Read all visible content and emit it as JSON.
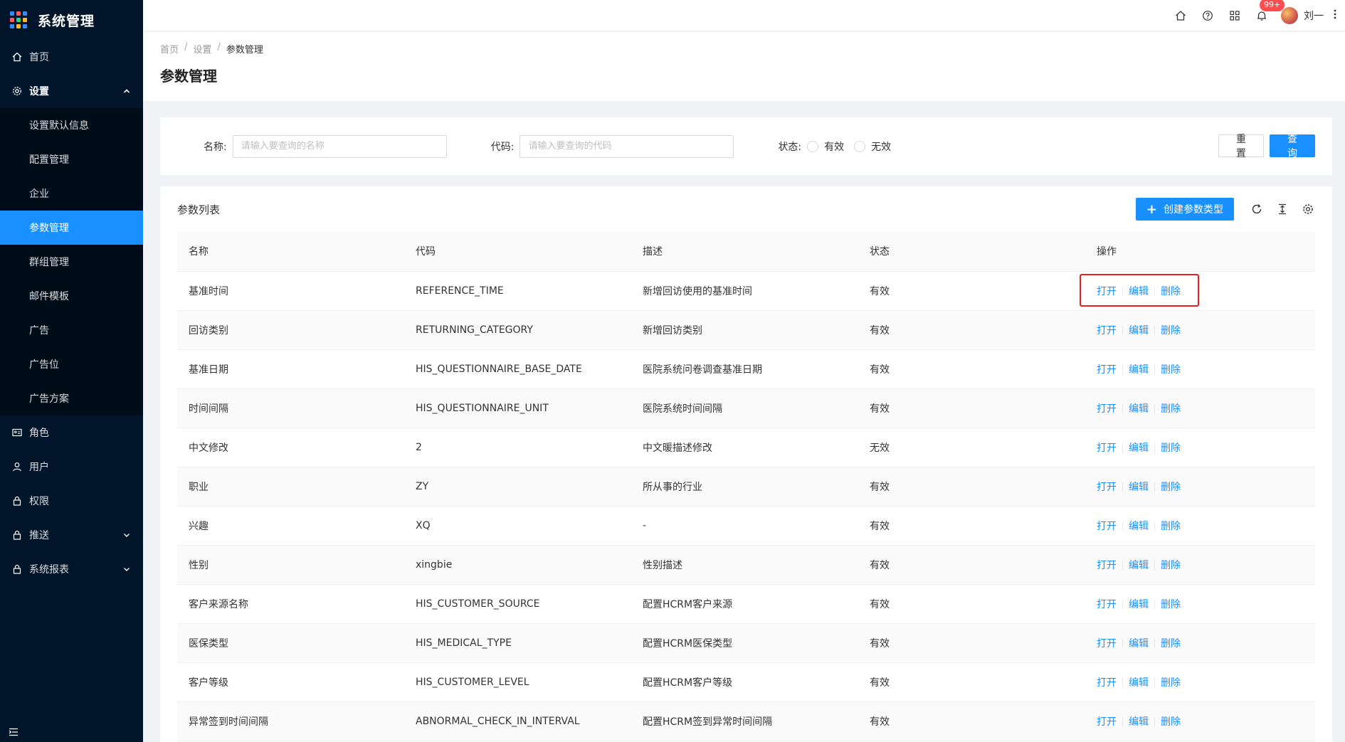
{
  "app": {
    "title": "系统管理"
  },
  "sidebar": {
    "home": "首页",
    "settings": "设置",
    "settings_children": [
      {
        "label": "设置默认信息",
        "active": false
      },
      {
        "label": "配置管理",
        "active": false
      },
      {
        "label": "企业",
        "active": false
      },
      {
        "label": "参数管理",
        "active": true
      },
      {
        "label": "群组管理",
        "active": false
      },
      {
        "label": "邮件模板",
        "active": false
      },
      {
        "label": "广告",
        "active": false
      },
      {
        "label": "广告位",
        "active": false
      },
      {
        "label": "广告方案",
        "active": false
      }
    ],
    "role": "角色",
    "user": "用户",
    "permission": "权限",
    "push": "推送",
    "report": "系统报表"
  },
  "header": {
    "badge": "99+",
    "user_name": "刘一",
    "icons": [
      "home-icon",
      "help-icon",
      "apps-icon",
      "bell-icon",
      "more-icon"
    ]
  },
  "breadcrumb": {
    "home": "首页",
    "settings": "设置",
    "current": "参数管理"
  },
  "page_title": "参数管理",
  "search": {
    "name_label": "名称:",
    "name_placeholder": "请输入要查询的名称",
    "code_label": "代码:",
    "code_placeholder": "请输入要查询的代码",
    "status_label": "状态:",
    "status_valid": "有效",
    "status_invalid": "无效",
    "reset": "重 置",
    "query": "查 询"
  },
  "table": {
    "title": "参数列表",
    "create": "创建参数类型",
    "columns": {
      "name": "名称",
      "code": "代码",
      "desc": "描述",
      "status": "状态",
      "ops": "操作"
    },
    "actions": {
      "open": "打开",
      "edit": "编辑",
      "delete": "删除"
    },
    "rows": [
      {
        "name": "基准时间",
        "code": "REFERENCE_TIME",
        "desc": "新增回访使用的基准时间",
        "status": "有效"
      },
      {
        "name": "回访类别",
        "code": "RETURNING_CATEGORY",
        "desc": "新增回访类别",
        "status": "有效"
      },
      {
        "name": "基准日期",
        "code": "HIS_QUESTIONNAIRE_BASE_DATE",
        "desc": "医院系统问卷调查基准日期",
        "status": "有效"
      },
      {
        "name": "时间间隔",
        "code": "HIS_QUESTIONNAIRE_UNIT",
        "desc": "医院系统时间间隔",
        "status": "有效"
      },
      {
        "name": "中文修改",
        "code": "2",
        "desc": "中文暖描述修改",
        "status": "无效"
      },
      {
        "name": "职业",
        "code": "ZY",
        "desc": "所从事的行业",
        "status": "有效"
      },
      {
        "name": "兴趣",
        "code": "XQ",
        "desc": "-",
        "status": "有效"
      },
      {
        "name": "性别",
        "code": "xingbie",
        "desc": "性别描述",
        "status": "有效"
      },
      {
        "name": "客户来源名称",
        "code": "HIS_CUSTOMER_SOURCE",
        "desc": "配置HCRM客户来源",
        "status": "有效"
      },
      {
        "name": "医保类型",
        "code": "HIS_MEDICAL_TYPE",
        "desc": "配置HCRM医保类型",
        "status": "有效"
      },
      {
        "name": "客户等级",
        "code": "HIS_CUSTOMER_LEVEL",
        "desc": "配置HCRM客户等级",
        "status": "有效"
      },
      {
        "name": "异常签到时间间隔",
        "code": "ABNORMAL_CHECK_IN_INTERVAL",
        "desc": "配置HCRM签到异常时间间隔",
        "status": "有效"
      }
    ]
  },
  "colors": {
    "primary": "#1890ff",
    "sidebar_bg": "#001529",
    "highlight": "#e61f1f"
  }
}
